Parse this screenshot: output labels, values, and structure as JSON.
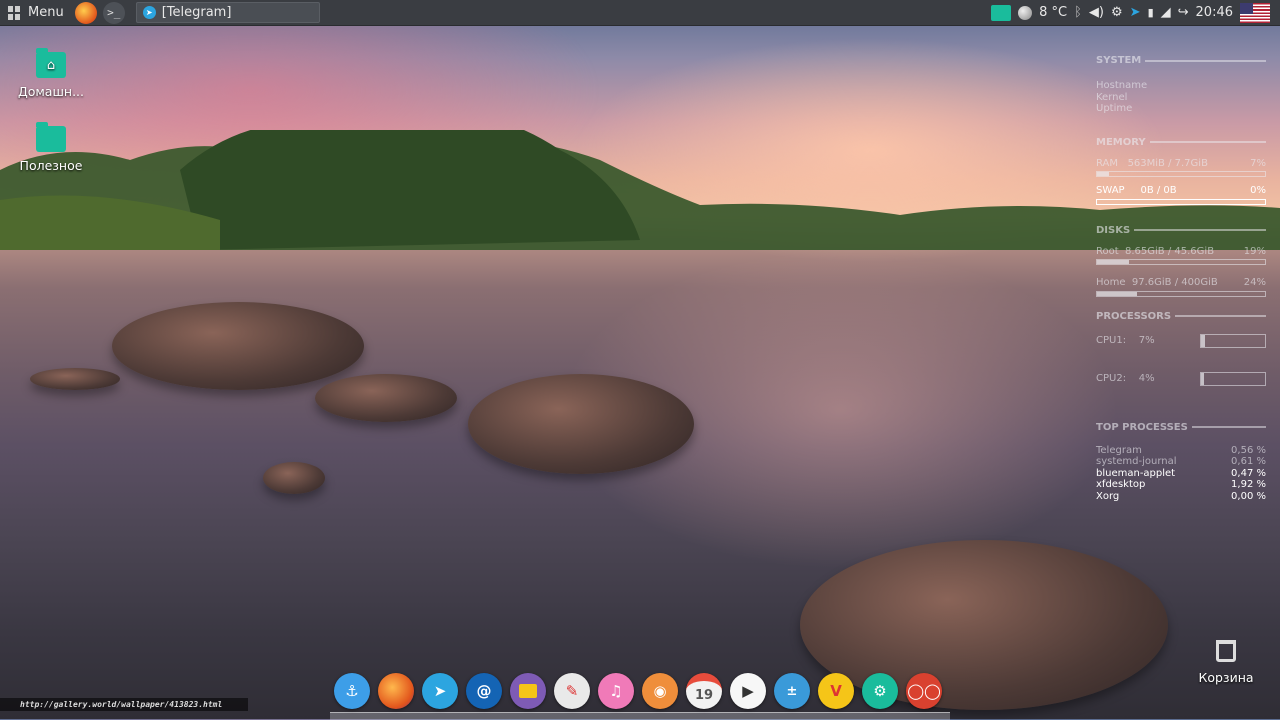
{
  "panel": {
    "menu_label": "Menu",
    "task_label": "[Telegram]",
    "temperature": "8 °C",
    "clock": "20:46",
    "icons": [
      "firefox-icon",
      "terminal-icon",
      "weather-icon",
      "bluetooth-icon",
      "volume-icon",
      "settings-icon",
      "telegram-icon",
      "network-icon",
      "logout-icon"
    ]
  },
  "desktop": {
    "home_label": "Домашн...",
    "useful_label": "Полезное",
    "trash_label": "Корзина"
  },
  "conky": {
    "system_title": "SYSTEM",
    "system_rows": [
      {
        "label": "Hostname",
        "value": ""
      },
      {
        "label": "Kernel",
        "value": ""
      },
      {
        "label": "Uptime",
        "value": ""
      },
      {
        "label": "",
        "value": ""
      }
    ],
    "memory_title": "MEMORY",
    "ram": {
      "label": "RAM",
      "value": "563MiB / 7.7GiB",
      "percent": "7%",
      "fraction": 0.07
    },
    "swap": {
      "label": "SWAP",
      "value": "0B / 0B",
      "percent": "0%",
      "fraction": 0
    },
    "disks_title": "DISKS",
    "root": {
      "label": "Root",
      "value": "8.65GiB / 45.6GiB",
      "percent": "19%",
      "fraction": 0.19
    },
    "home": {
      "label": "Home",
      "value": "97.6GiB / 400GiB",
      "percent": "24%",
      "fraction": 0.24
    },
    "processors_title": "PROCESSORS",
    "cpu1": {
      "label": "CPU1:",
      "value": "7%",
      "fraction": 0.07
    },
    "cpu2": {
      "label": "CPU2:",
      "value": "4%",
      "fraction": 0.04
    },
    "top_title": "TOP PROCESSES",
    "processes": [
      {
        "name": "Telegram",
        "value": "0,56 %"
      },
      {
        "name": "systemd-journal",
        "value": "0,61 %"
      },
      {
        "name": "blueman-applet",
        "value": "0,47 %"
      },
      {
        "name": "xfdesktop",
        "value": "1,92 %"
      },
      {
        "name": "Xorg",
        "value": "0,00 %"
      }
    ]
  },
  "dock": {
    "calendar_day": "19",
    "items": [
      "anchor-icon",
      "firefox-icon",
      "telegram-icon",
      "mail-icon",
      "files-icon",
      "text-editor-icon",
      "music-player-icon",
      "gimp-icon",
      "calendar-icon",
      "media-player-icon",
      "calculator-icon",
      "vivaldi-icon",
      "settings-icon",
      "screen-recorder-icon"
    ]
  },
  "watermark": "http://gallery.world/wallpaper/413823.html"
}
